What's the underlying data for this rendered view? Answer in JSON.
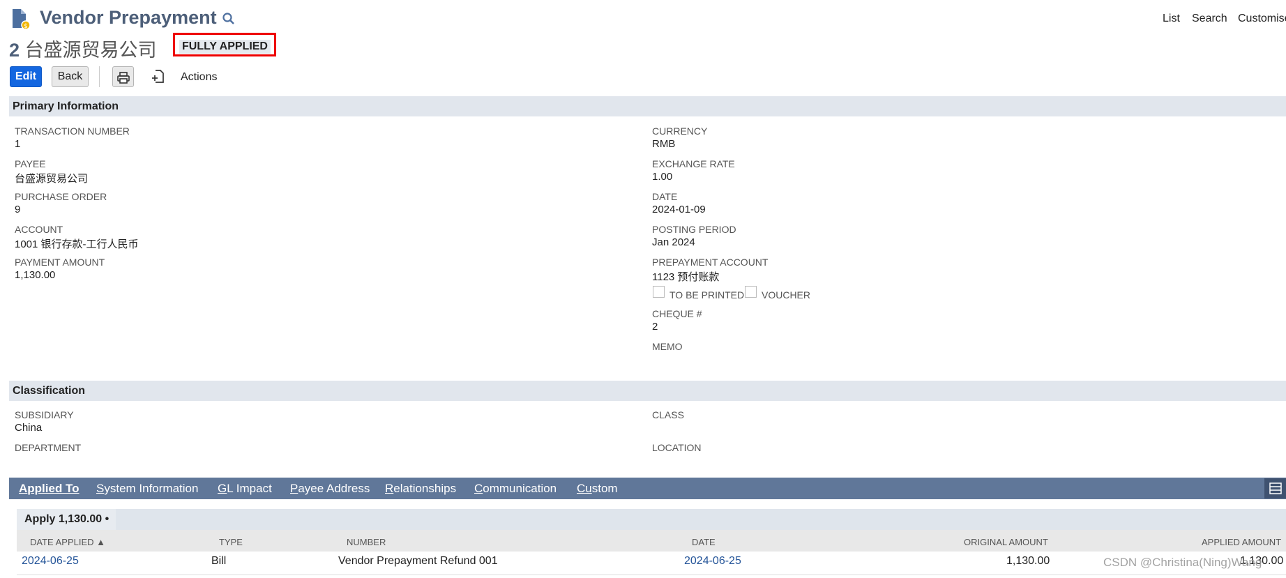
{
  "header": {
    "title": "Vendor Prepayment",
    "record_number": "2",
    "record_name": "台盛源贸易公司",
    "status": "FULLY APPLIED",
    "nav": [
      "List",
      "Search",
      "Customise"
    ]
  },
  "toolbar": {
    "edit": "Edit",
    "back": "Back",
    "actions": "Actions"
  },
  "primary": {
    "section_title": "Primary Information",
    "left": [
      {
        "label": "TRANSACTION NUMBER",
        "value": "1"
      },
      {
        "label": "PAYEE",
        "value": "台盛源贸易公司"
      },
      {
        "label": "PURCHASE ORDER",
        "value": "9"
      },
      {
        "label": "ACCOUNT",
        "value": "1001 银行存款-工行人民币"
      },
      {
        "label": "PAYMENT AMOUNT",
        "value": "1,130.00"
      }
    ],
    "right": [
      {
        "label": "CURRENCY",
        "value": "RMB"
      },
      {
        "label": "EXCHANGE RATE",
        "value": "1.00"
      },
      {
        "label": "DATE",
        "value": "2024-01-09"
      },
      {
        "label": "POSTING PERIOD",
        "value": "Jan 2024"
      },
      {
        "label": "PREPAYMENT ACCOUNT",
        "value": "1123 预付账款"
      }
    ],
    "to_be_printed": "TO BE PRINTED",
    "voucher": "VOUCHER",
    "cheque_label": "CHEQUE #",
    "cheque_value": "2",
    "memo_label": "MEMO"
  },
  "classification": {
    "section_title": "Classification",
    "subsidiary_label": "SUBSIDIARY",
    "subsidiary_value": "China",
    "department_label": "DEPARTMENT",
    "class_label": "CLASS",
    "location_label": "LOCATION"
  },
  "tabs": [
    {
      "first": "A",
      "rest": "pplied To"
    },
    {
      "first": "S",
      "rest": "ystem Information"
    },
    {
      "first": "G",
      "rest": "L Impact"
    },
    {
      "first": "P",
      "rest": "ayee Address"
    },
    {
      "first": "R",
      "rest": "elationships"
    },
    {
      "first": "C",
      "rest": "ommunication"
    },
    {
      "first": "Cu",
      "rest": "stom"
    }
  ],
  "apply": {
    "label": "Apply 1,130.00 •",
    "columns": [
      "DATE APPLIED ▲",
      "TYPE",
      "NUMBER",
      "DATE",
      "ORIGINAL AMOUNT",
      "APPLIED AMOUNT"
    ],
    "rows": [
      {
        "date_applied": "2024-06-25",
        "type": "Bill",
        "number": "Vendor Prepayment Refund 001",
        "date": "2024-06-25",
        "original": "1,130.00",
        "applied": "1,130.00"
      }
    ]
  },
  "watermark": "CSDN @Christina(Ning)Wang",
  "colors": {
    "accent": "#1467e0",
    "tabbar": "#607799",
    "section": "#e1e6ed",
    "link": "#255599",
    "highlight": "#e00000"
  }
}
